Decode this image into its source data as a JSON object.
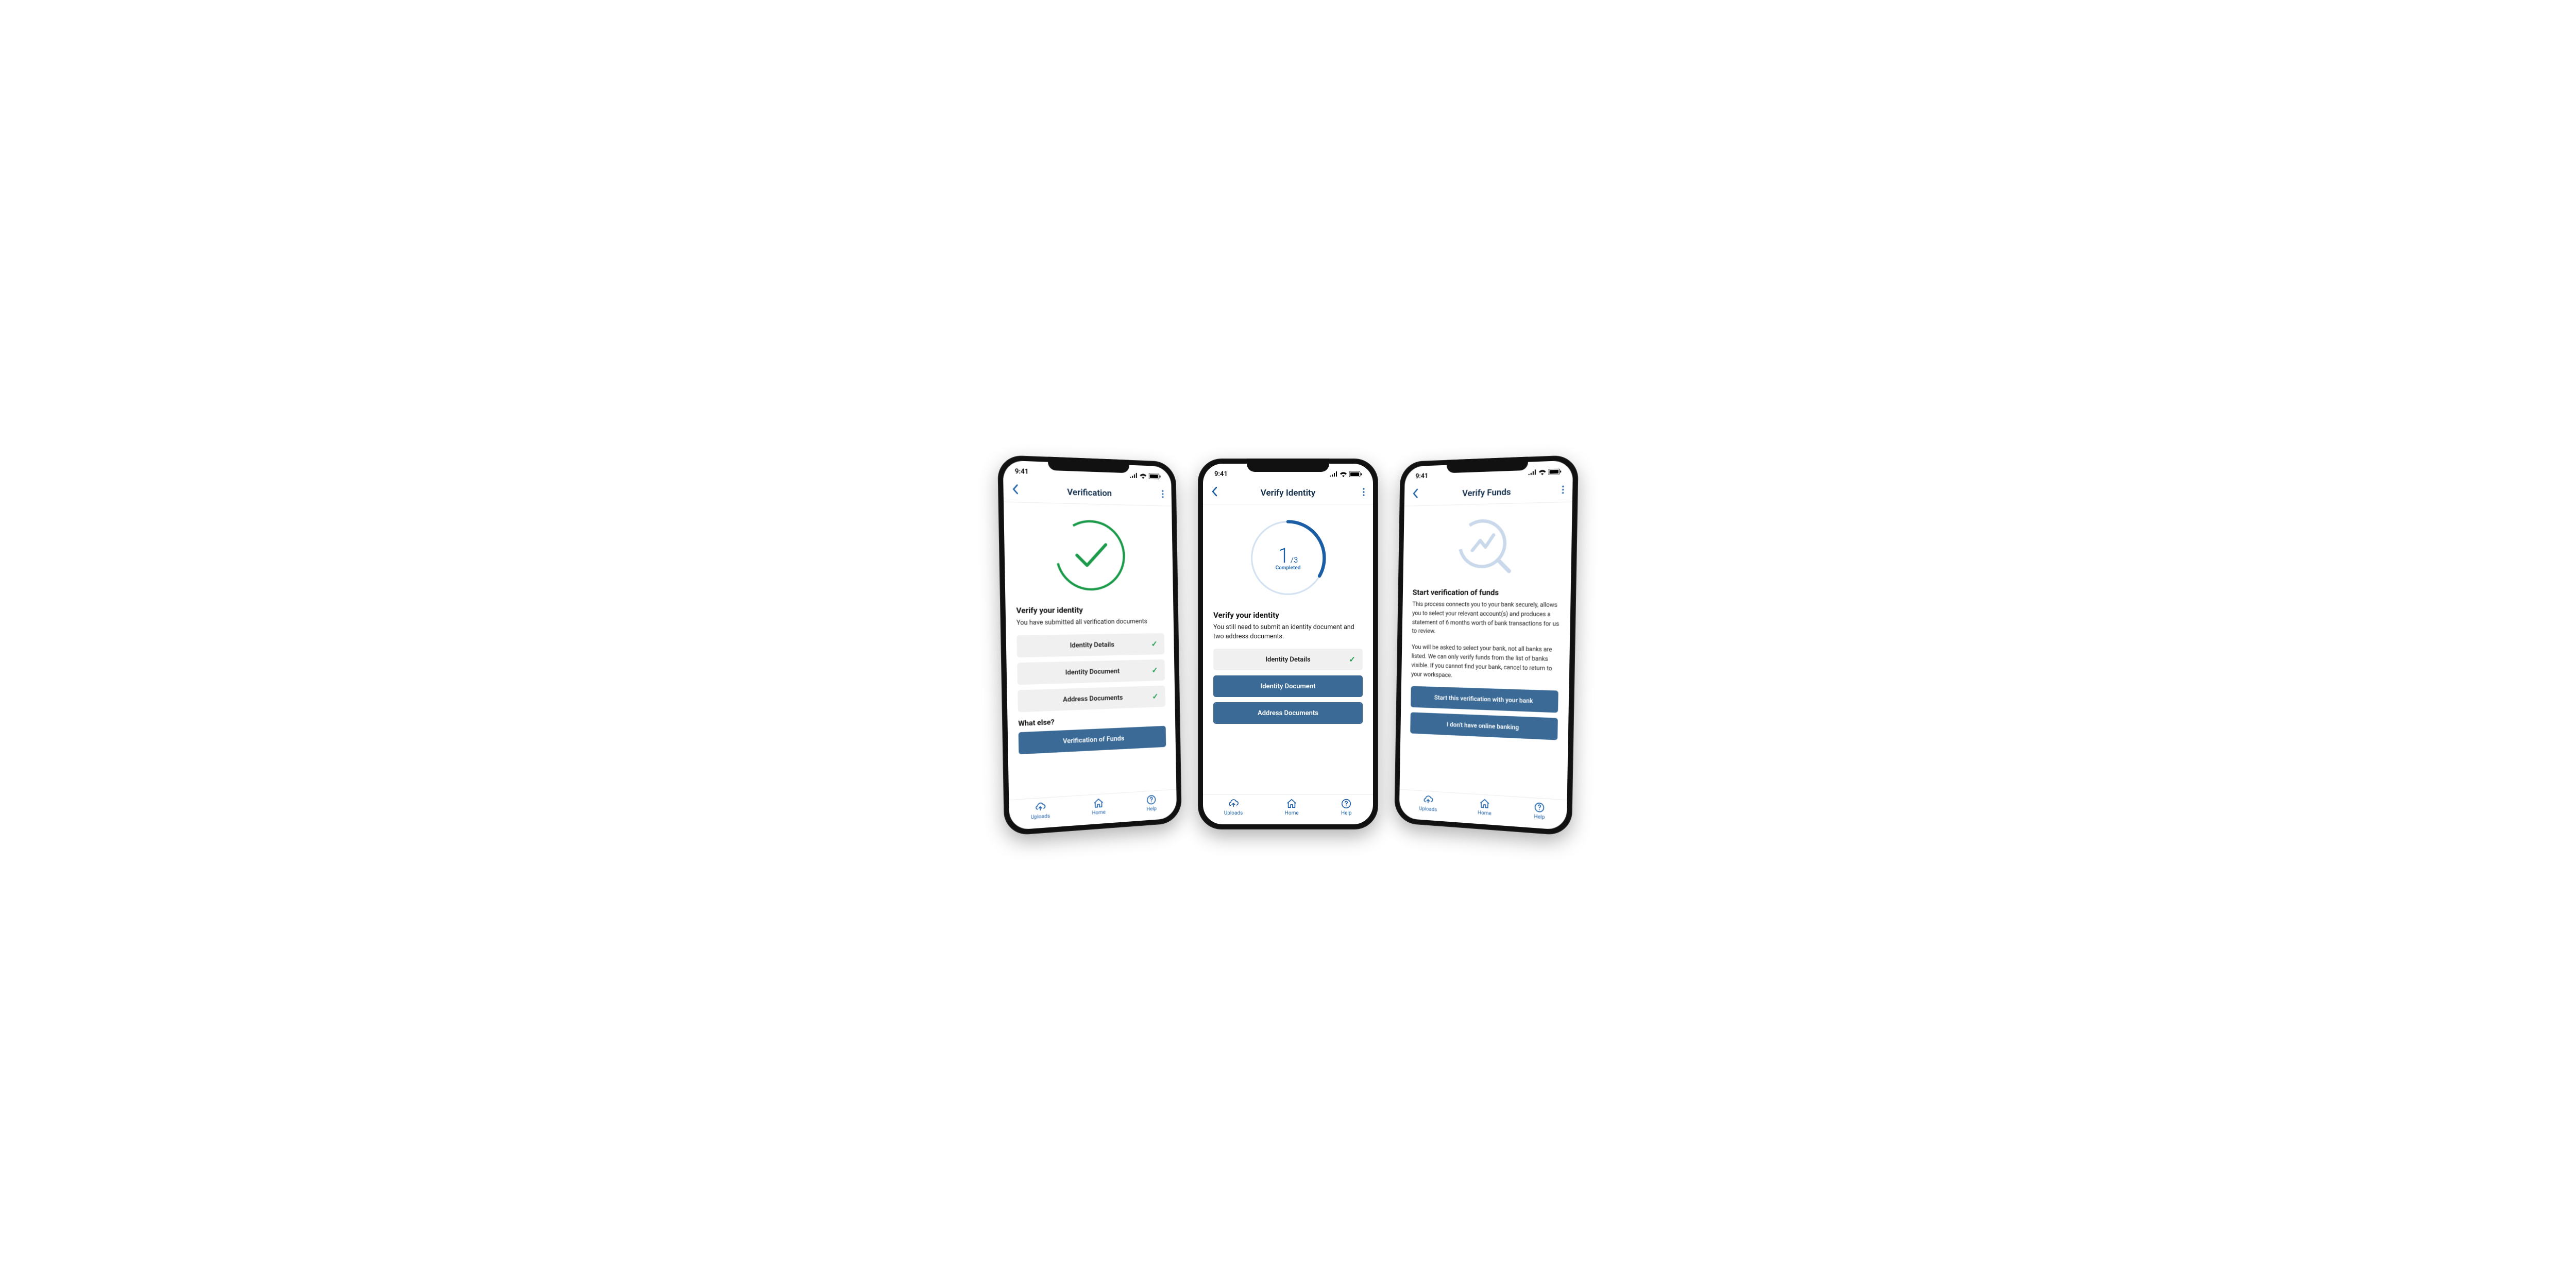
{
  "status_time": "9:41",
  "tabs": {
    "uploads": "Uploads",
    "home": "Home",
    "help": "Help"
  },
  "screen1": {
    "title": "Verification",
    "heading": "Verify your identity",
    "subtext": "You have submitted all verification documents",
    "items": {
      "identity_details": "Identity Details",
      "identity_document": "Identity Document",
      "address_documents": "Address Documents"
    },
    "what_else": "What else?",
    "funds_btn": "Verification of Funds"
  },
  "screen2": {
    "title": "Verify Identity",
    "progress": {
      "done": "1",
      "total": "/3",
      "label": "Completed"
    },
    "heading": "Verify your identity",
    "subtext": "You still need to submit an identity document and two address documents.",
    "items": {
      "identity_details": "Identity Details",
      "identity_document": "Identity Document",
      "address_documents": "Address Documents"
    }
  },
  "screen3": {
    "title": "Verify Funds",
    "heading": "Start verification of funds",
    "para1": "This process connects you to your bank securely, allows you to select your relevant account(s) and produces a statement of 6 months worth of bank transactions for us to review.",
    "para2": "You will be asked to select your bank, not all banks are listed. We can only verify funds from the list of banks visible. If you cannot find your bank, cancel to return to your workspace.",
    "start_btn": "Start this verification with your bank",
    "no_online_btn": "I don't have online banking"
  }
}
